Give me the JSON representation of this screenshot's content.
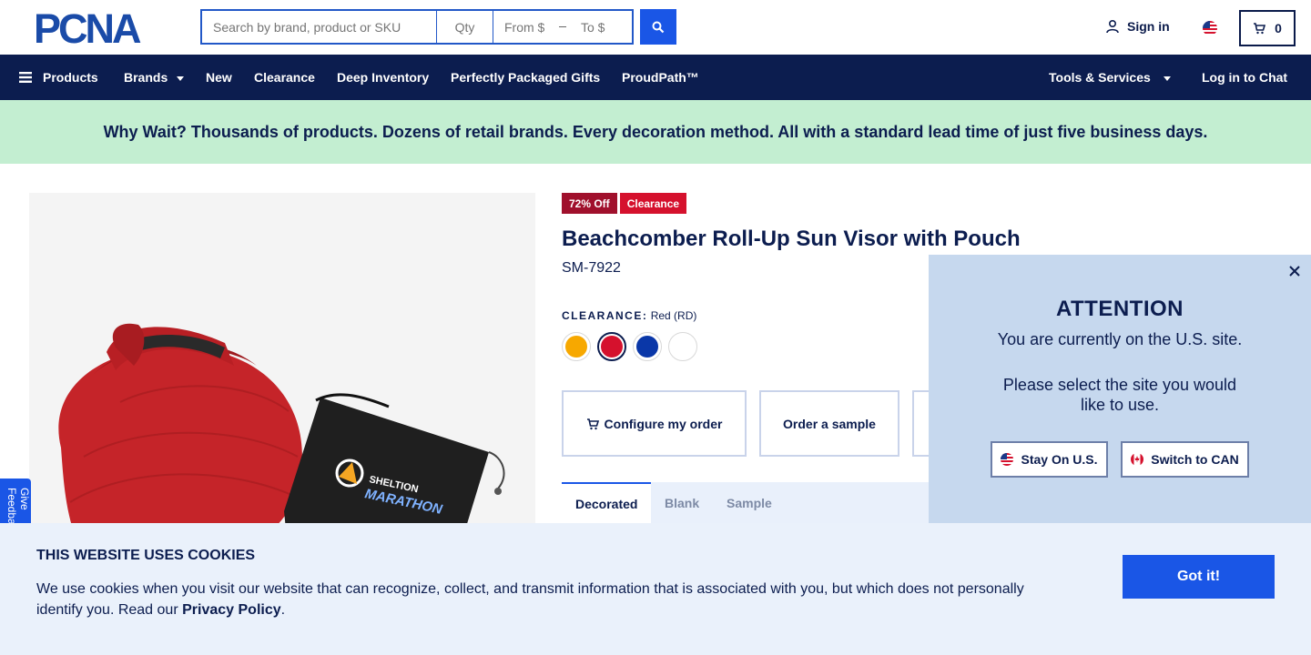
{
  "header": {
    "logo_text": "PCNA",
    "search": {
      "placeholder": "Search by brand, product or SKU",
      "qty_placeholder": "Qty",
      "from_placeholder": "From $",
      "to_placeholder": "To $"
    },
    "sign_in_label": "Sign in",
    "cart_count": "0"
  },
  "nav": {
    "products_label": "Products",
    "brands_label": "Brands",
    "new_label": "New",
    "clearance_label": "Clearance",
    "deep_inventory_label": "Deep Inventory",
    "gifts_label": "Perfectly Packaged Gifts",
    "proudpath_label": "ProudPath™",
    "tools_label": "Tools & Services",
    "chat_label": "Log in to Chat"
  },
  "promo": {
    "text": "Why Wait? Thousands of products. Dozens of retail brands. Every decoration method. All with a standard lead time of just five business days."
  },
  "product": {
    "discount_badge": "72% Off",
    "clearance_badge": "Clearance",
    "title": "Beachcomber Roll-Up Sun Visor with Pouch",
    "sku": "SM-7922",
    "color_label": "CLEARANCE:",
    "color_value": "Red (RD)",
    "swatches": [
      {
        "name": "orange",
        "color": "#f7a800"
      },
      {
        "name": "red",
        "color": "#d5112d"
      },
      {
        "name": "blue",
        "color": "#0a37a8"
      },
      {
        "name": "white",
        "color": "#ffffff"
      }
    ],
    "pouch_print": [
      "SHELTION",
      "MARATHON"
    ],
    "configure_label": "Configure my order",
    "sample_label": "Order a sample",
    "tabs": [
      "Decorated",
      "Blank",
      "Sample"
    ]
  },
  "feedback": {
    "label": "Give Feedback"
  },
  "attention": {
    "title": "ATTENTION",
    "message1": "You are currently on the U.S. site.",
    "message2": "Please select the site you would like to use.",
    "stay_label": "Stay On U.S.",
    "switch_label": "Switch to CAN"
  },
  "cookie": {
    "title": "THIS WEBSITE USES COOKIES",
    "text": "We use cookies when you visit our website that can recognize, collect, and transmit information that is associated with you, but which does not personally identify you. Read our",
    "link": "Privacy Policy",
    "period": ".",
    "button": "Got it!"
  },
  "colors": {
    "brand_navy": "#0c1d4f",
    "accent_blue": "#1a56e6",
    "promo_bg": "#c3eed1",
    "clearance_red": "#d5112d"
  },
  "icons": [
    "search-icon",
    "user-icon",
    "us-flag-icon",
    "cart-icon",
    "hamburger-icon",
    "close-icon",
    "canada-flag-icon"
  ]
}
